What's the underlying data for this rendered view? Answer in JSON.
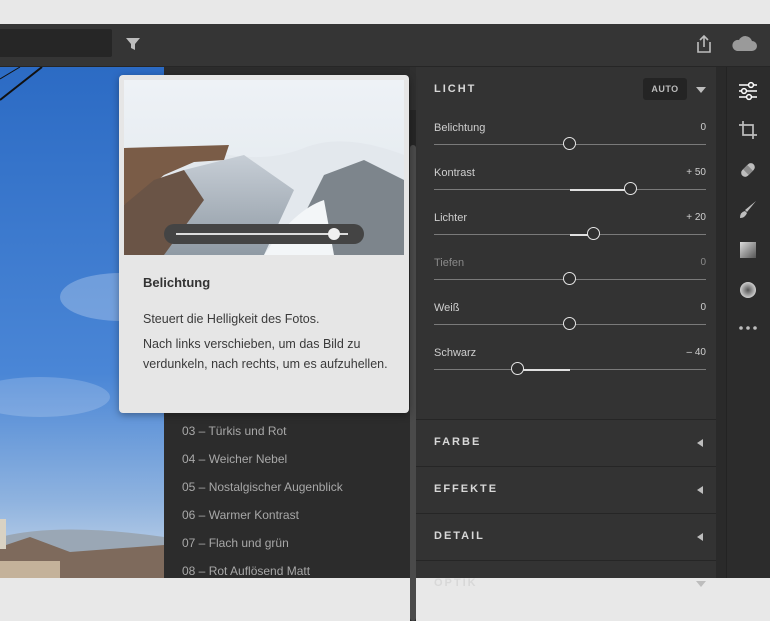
{
  "header": {
    "filter_icon": "filter-icon",
    "share_icon": "share-icon",
    "cloud_icon": "cloud-icon"
  },
  "presets": [
    "03 – Türkis und Rot",
    "04 – Weicher Nebel",
    "05 – Nostalgischer Augenblick",
    "06 – Warmer Kontrast",
    "07 – Flach und grün",
    "08 – Rot Auflösend Matt"
  ],
  "panel": {
    "light_title": "LICHT",
    "auto_label": "AUTO",
    "sliders": [
      {
        "label": "Belichtung",
        "value": "0",
        "level": 0.5,
        "enabled": true
      },
      {
        "label": "Kontrast",
        "value": "+ 50",
        "level": 0.725,
        "enabled": true
      },
      {
        "label": "Lichter",
        "value": "+ 20",
        "level": 0.59,
        "enabled": true
      },
      {
        "label": "Tiefen",
        "value": "0",
        "level": 0.5,
        "enabled": false
      },
      {
        "label": "Weiß",
        "value": "0",
        "level": 0.5,
        "enabled": true
      },
      {
        "label": "Schwarz",
        "value": "– 40",
        "level": 0.31,
        "enabled": true
      }
    ],
    "sections": [
      {
        "label": "FARBE",
        "state": "collapsed"
      },
      {
        "label": "EFFEKTE",
        "state": "collapsed"
      },
      {
        "label": "DETAIL",
        "state": "collapsed"
      },
      {
        "label": "OPTIK",
        "state": "expanded"
      }
    ]
  },
  "tooltip": {
    "title": "Belichtung",
    "line1": "Steuert die Helligkeit des Fotos.",
    "line2": "Nach links verschieben, um das Bild zu verdunkeln, nach rechts, um es aufzuhellen.",
    "demo_slider_level": 0.92
  },
  "toolrail": [
    "edit-sliders-icon",
    "crop-icon",
    "healing-icon",
    "brush-icon",
    "linear-gradient-icon",
    "radial-gradient-icon",
    "more-icon"
  ],
  "colors": {
    "accent": "#e6e6e6",
    "panel": "#333333",
    "tooltip": "#e6e6e6"
  }
}
